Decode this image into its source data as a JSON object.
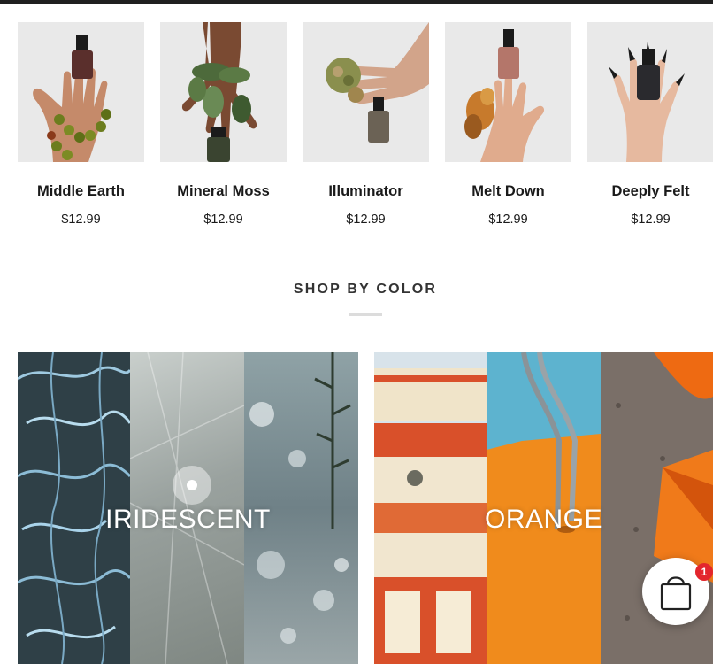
{
  "products": [
    {
      "name": "Middle Earth",
      "price": "$12.99",
      "image_icon": "hand-holding-nail-polish-icon"
    },
    {
      "name": "Mineral Moss",
      "price": "$12.99",
      "image_icon": "hand-holding-nail-polish-icon"
    },
    {
      "name": "Illuminator",
      "price": "$12.99",
      "image_icon": "hand-holding-nail-polish-icon"
    },
    {
      "name": "Melt Down",
      "price": "$12.99",
      "image_icon": "hand-holding-nail-polish-icon"
    },
    {
      "name": "Deeply Felt",
      "price": "$12.99",
      "image_icon": "hand-holding-nail-polish-icon"
    }
  ],
  "shop_by_color": {
    "title": "SHOP BY COLOR",
    "tiles": [
      {
        "label": "IRIDESCENT"
      },
      {
        "label": "ORANGE"
      }
    ]
  },
  "cart": {
    "count": "1",
    "icon": "shopping-bag-icon"
  },
  "colors": {
    "topbar": "#1f1f1f",
    "badge": "#e3262d",
    "orange": "#ee8a1e",
    "sky": "#5db3cf"
  }
}
